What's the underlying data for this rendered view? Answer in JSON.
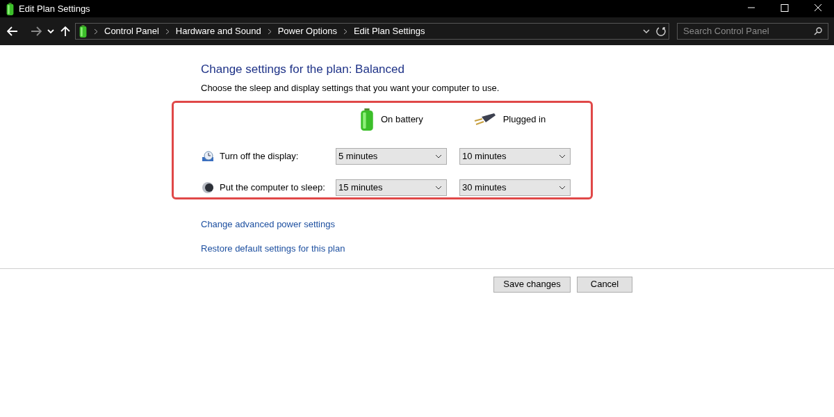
{
  "window": {
    "title": "Edit Plan Settings"
  },
  "address_bar": {
    "breadcrumbs": [
      "Control Panel",
      "Hardware and Sound",
      "Power Options",
      "Edit Plan Settings"
    ]
  },
  "search": {
    "placeholder": "Search Control Panel"
  },
  "heading": "Change settings for the plan: Balanced",
  "description": "Choose the sleep and display settings that you want your computer to use.",
  "columns": [
    {
      "kind": "battery",
      "label": "On battery"
    },
    {
      "kind": "plug",
      "label": "Plugged in"
    }
  ],
  "settings": [
    {
      "kind": "display",
      "label": "Turn off the display:",
      "values": [
        "5 minutes",
        "10 minutes"
      ]
    },
    {
      "kind": "sleep",
      "label": "Put the computer to sleep:",
      "values": [
        "15 minutes",
        "30 minutes"
      ]
    }
  ],
  "links": [
    "Change advanced power settings",
    "Restore default settings for this plan"
  ],
  "buttons": [
    "Save changes",
    "Cancel"
  ]
}
